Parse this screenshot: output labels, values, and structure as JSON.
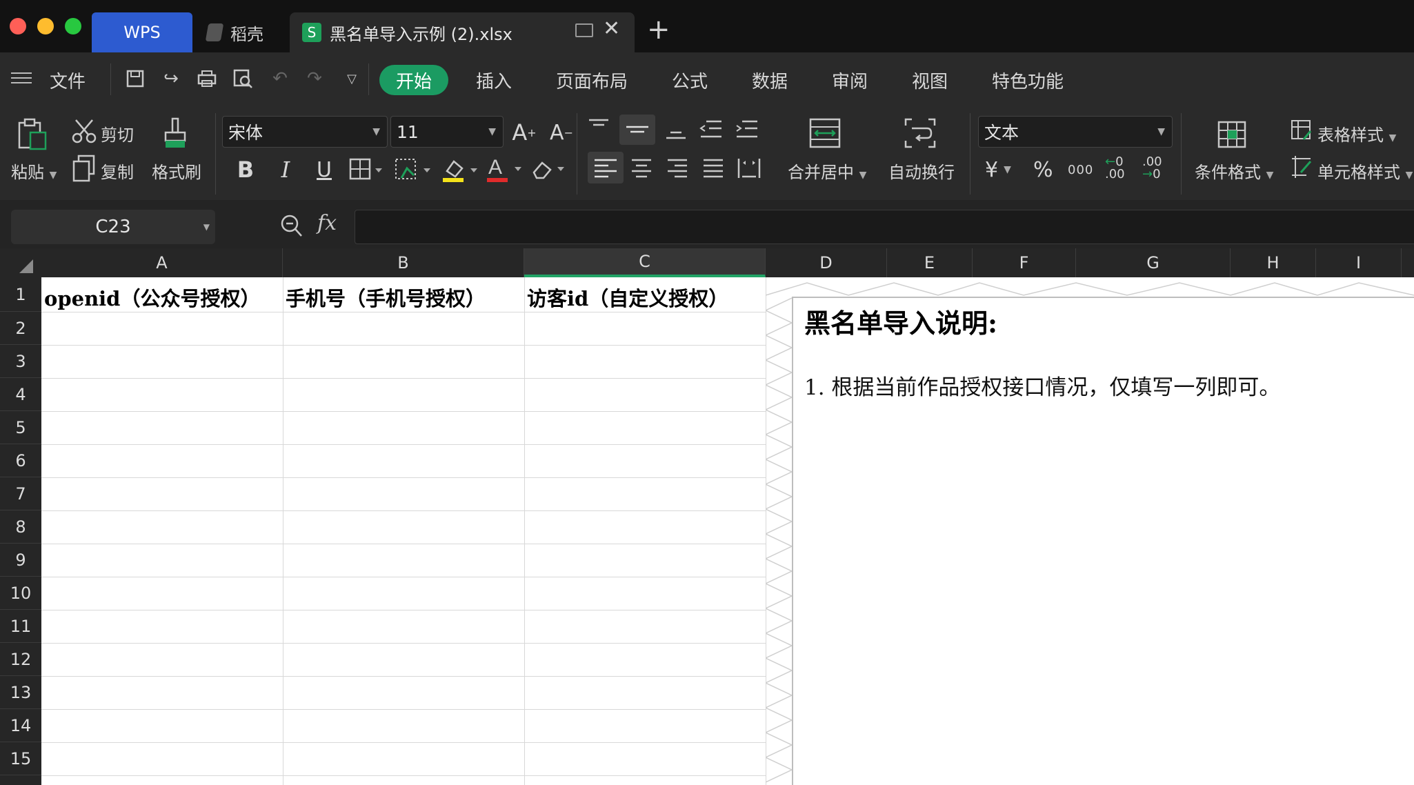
{
  "window": {
    "tabs": [
      {
        "label": "WPS"
      },
      {
        "label": "稻壳"
      },
      {
        "label": "黑名单导入示例 (2).xlsx",
        "badge": "S"
      }
    ],
    "new_tab": "+"
  },
  "menu": {
    "file": "文件",
    "items": [
      "开始",
      "插入",
      "页面布局",
      "公式",
      "数据",
      "审阅",
      "视图",
      "特色功能"
    ],
    "active": "开始"
  },
  "ribbon": {
    "paste": "粘贴",
    "cut": "剪切",
    "copy": "复制",
    "format_painter": "格式刷",
    "font_name": "宋体",
    "font_size": "11",
    "bold": "B",
    "italic": "I",
    "underline": "U",
    "merge_center": "合并居中",
    "wrap_text": "自动换行",
    "number_format": "文本",
    "currency": "¥",
    "percent": "%",
    "thousands": "000",
    "inc_decimal": ".00",
    "dec_decimal": ".00",
    "conditional_format": "条件格式",
    "table_style": "表格样式",
    "cell_style": "单元格样式",
    "increase_font": "A",
    "decrease_font": "A",
    "font_color_glyph": "A"
  },
  "formula_bar": {
    "name_box": "C23",
    "fx": "fx",
    "content": ""
  },
  "grid": {
    "columns": [
      "A",
      "B",
      "C",
      "D",
      "E",
      "F",
      "G",
      "H",
      "I"
    ],
    "selected_column": "C",
    "rows": [
      "1",
      "2",
      "3",
      "4",
      "5",
      "6",
      "7",
      "8",
      "9",
      "10",
      "11",
      "12",
      "13",
      "14",
      "15"
    ],
    "header_cells": {
      "A1": "openid（公众号授权）",
      "B1": "手机号（手机号授权）",
      "C1": "访客id（自定义授权）"
    }
  },
  "textbox": {
    "title": "黑名单导入说明:",
    "line1": "1. 根据当前作品授权接口情况，仅填写一列即可。"
  },
  "colors": {
    "accent_green": "#1b9b62",
    "wps_tab_blue": "#2d5bd0",
    "selected_col_underline": "#21a366"
  }
}
